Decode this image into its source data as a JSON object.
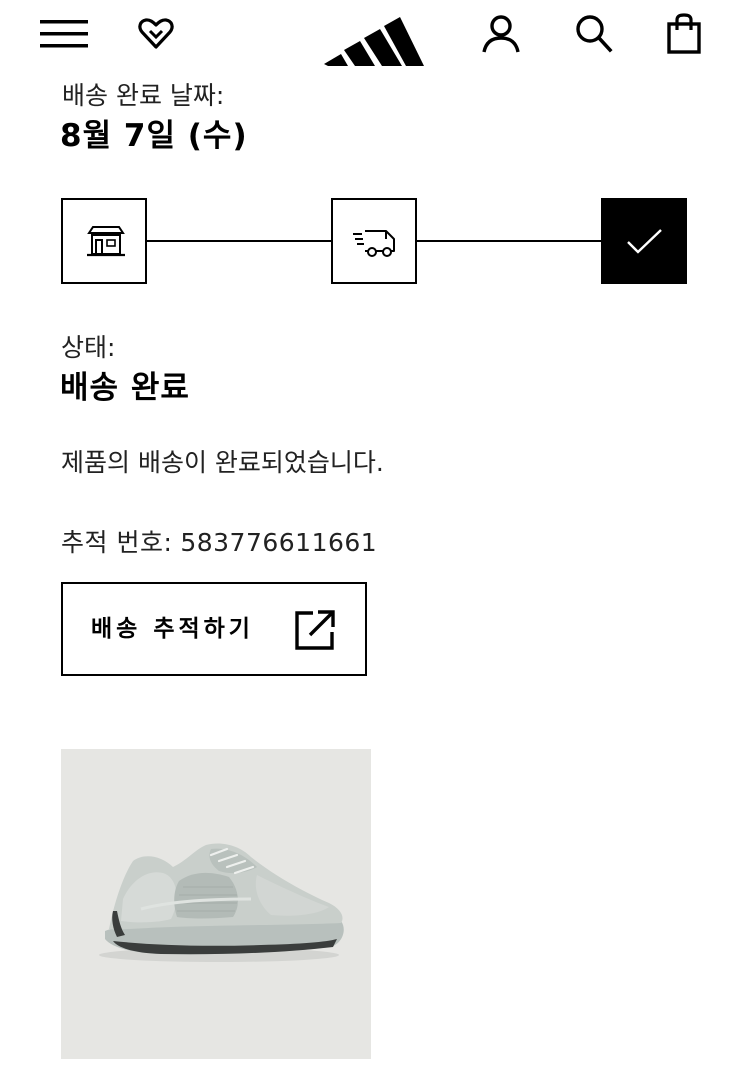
{
  "header": {
    "icons": {
      "menu": "hamburger-menu-icon",
      "wishlist": "heart-icon",
      "logo": "brand-logo",
      "account": "user-icon",
      "search": "search-icon",
      "bag": "shopping-bag-icon"
    }
  },
  "delivery": {
    "date_label": "배송 완료 날짜:",
    "date_value": "8월 7일 (수)"
  },
  "progress": {
    "steps": [
      {
        "icon": "store-icon",
        "state": "done"
      },
      {
        "icon": "delivery-truck-icon",
        "state": "done"
      },
      {
        "icon": "checkmark-icon",
        "state": "current"
      }
    ]
  },
  "status": {
    "label": "상태:",
    "value": "배송 완료",
    "message": "제품의 배송이 완료되었습니다."
  },
  "tracking": {
    "label": "추적 번호:",
    "number": "583776611661",
    "button_label": "배송 추적하기",
    "button_icon": "external-link-icon"
  },
  "product": {
    "image_icon": "sneaker-image",
    "colors": {
      "background": "#e6e6e3",
      "upper": "#c9cfcb",
      "sole": "#b8c0bd",
      "accent": "#3a3d3c"
    }
  },
  "colors": {
    "text": "#000000",
    "background": "#ffffff",
    "active_step": "#000000"
  }
}
